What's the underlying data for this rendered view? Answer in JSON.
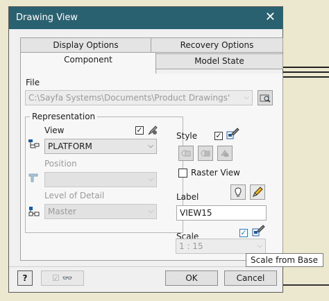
{
  "dialog": {
    "title": "Drawing View",
    "close_glyph": "✕"
  },
  "tabs": {
    "display_options": "Display Options",
    "recovery_options": "Recovery Options",
    "component": "Component",
    "model_state": "Model State"
  },
  "file": {
    "label": "File",
    "path": "C:\\Sayfa Systems\\Documents\\Product Drawings'"
  },
  "representation": {
    "title": "Representation",
    "view_label": "View",
    "view_value": "PLATFORM",
    "view_checked": true,
    "position_label": "Position",
    "position_value": "",
    "level_label": "Level of Detail",
    "level_value": "Master"
  },
  "style": {
    "label": "Style",
    "checked": true,
    "raster_label": "Raster View",
    "raster_checked": false
  },
  "label": {
    "label": "Label",
    "value": "VIEW15"
  },
  "scale": {
    "label": "Scale",
    "value": "1 : 15",
    "checked": true
  },
  "tooltip": "Scale from Base",
  "buttons": {
    "ok": "OK",
    "cancel": "Cancel",
    "help_glyph": "?"
  },
  "colors": {
    "titlebar": "#2a6171",
    "accent": "#2a78c8"
  }
}
